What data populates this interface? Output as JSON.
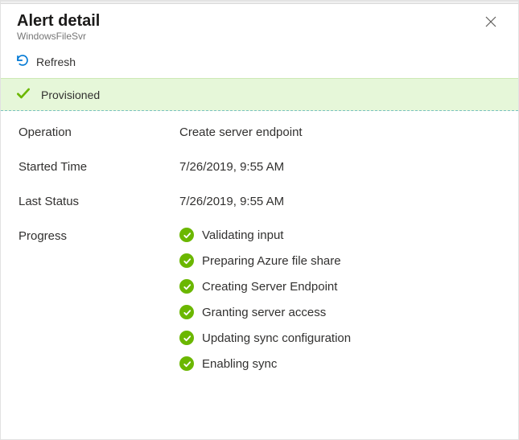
{
  "colors": {
    "accent": "#0078d4",
    "success": "#6bb700",
    "bannerBg": "#e6f7d9"
  },
  "header": {
    "title": "Alert detail",
    "subtitle": "WindowsFileSvr"
  },
  "toolbar": {
    "refresh_label": "Refresh"
  },
  "status": {
    "label": "Provisioned"
  },
  "details": {
    "operation_label": "Operation",
    "operation_value": "Create server endpoint",
    "started_label": "Started Time",
    "started_value": "7/26/2019, 9:55 AM",
    "laststatus_label": "Last Status",
    "laststatus_value": "7/26/2019, 9:55 AM",
    "progress_label": "Progress"
  },
  "progress_items": [
    "Validating input",
    "Preparing Azure file share",
    "Creating Server Endpoint",
    "Granting server access",
    "Updating sync configuration",
    "Enabling sync"
  ]
}
